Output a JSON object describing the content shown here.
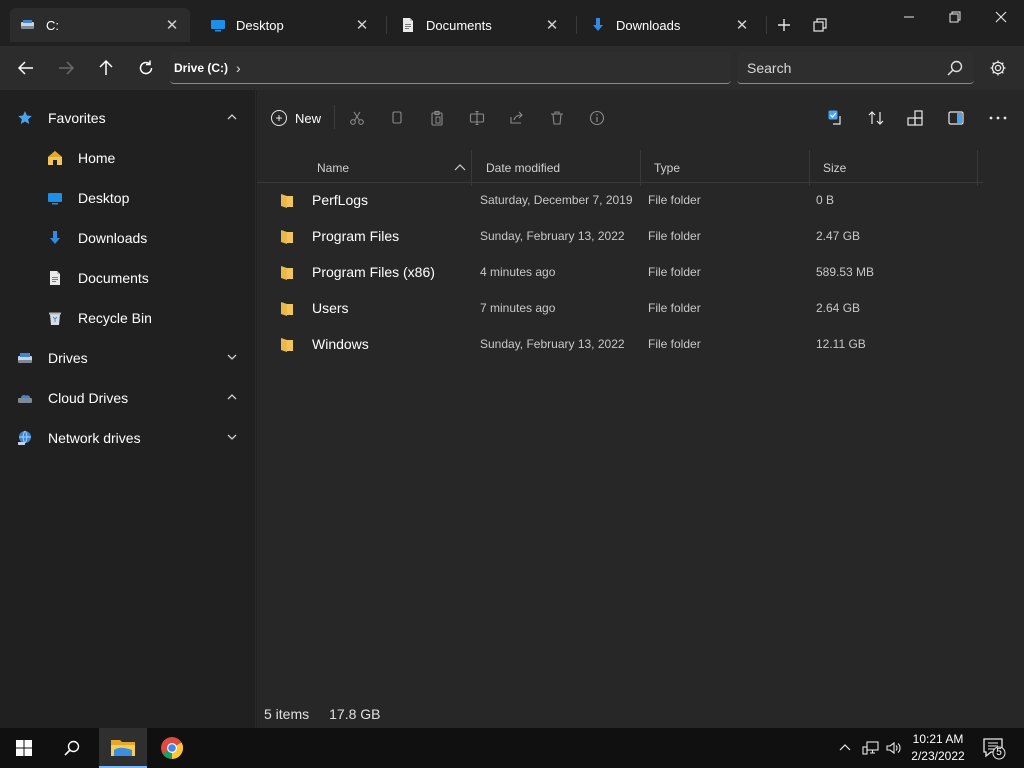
{
  "tabs": [
    {
      "label": "C:",
      "icon": "drive-icon",
      "active": true
    },
    {
      "label": "Desktop",
      "icon": "desktop-icon",
      "active": false
    },
    {
      "label": "Documents",
      "icon": "document-icon",
      "active": false
    },
    {
      "label": "Downloads",
      "icon": "download-icon",
      "active": false
    }
  ],
  "address": {
    "crumb": "Drive (C:)",
    "separator": "›"
  },
  "search": {
    "placeholder": "Search"
  },
  "sidebar": {
    "favorites_label": "Favorites",
    "favorites": [
      {
        "label": "Home",
        "icon": "home-icon"
      },
      {
        "label": "Desktop",
        "icon": "desktop-icon"
      },
      {
        "label": "Downloads",
        "icon": "download-icon"
      },
      {
        "label": "Documents",
        "icon": "document-icon"
      },
      {
        "label": "Recycle Bin",
        "icon": "recycle-bin-icon"
      }
    ],
    "drives_label": "Drives",
    "cloud_label": "Cloud Drives",
    "network_label": "Network drives"
  },
  "toolbar": {
    "new_label": "New"
  },
  "columns": {
    "name": "Name",
    "date": "Date modified",
    "type": "Type",
    "size": "Size"
  },
  "files": [
    {
      "name": "PerfLogs",
      "date": "Saturday, December 7, 2019",
      "type": "File folder",
      "size": "0 B"
    },
    {
      "name": "Program Files",
      "date": "Sunday, February 13, 2022",
      "type": "File folder",
      "size": "2.47 GB"
    },
    {
      "name": "Program Files (x86)",
      "date": "4 minutes ago",
      "type": "File folder",
      "size": "589.53 MB"
    },
    {
      "name": "Users",
      "date": "7 minutes ago",
      "type": "File folder",
      "size": "2.64 GB"
    },
    {
      "name": "Windows",
      "date": "Sunday, February 13, 2022",
      "type": "File folder",
      "size": "12.11 GB"
    }
  ],
  "status": {
    "items": "5 items",
    "size": "17.8 GB"
  },
  "taskbar": {
    "time": "10:21 AM",
    "date": "2/23/2022",
    "notification_count": "5"
  },
  "colors": {
    "accent": "#4aa3f0",
    "folder": "#f2c55c",
    "background": "#202020",
    "content_background": "#272727"
  }
}
